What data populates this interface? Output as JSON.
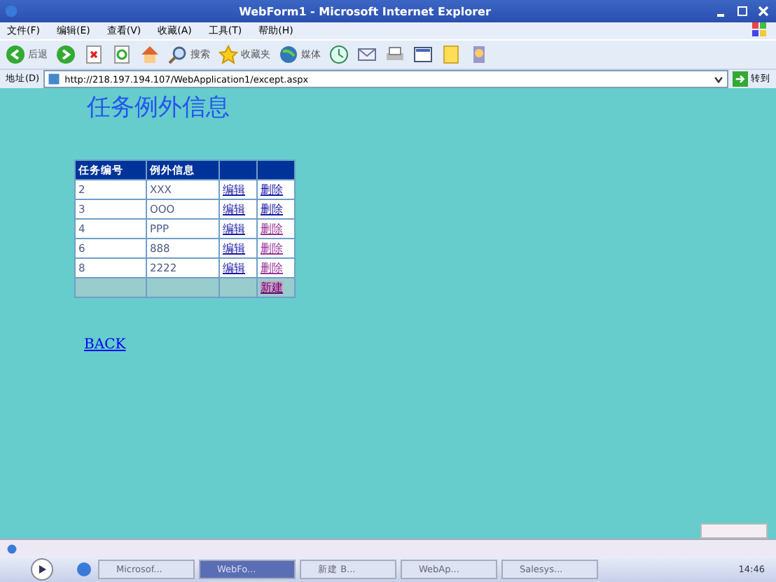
{
  "window": {
    "title": "WebForm1 - Microsoft Internet Explorer"
  },
  "menu": [
    "文件(F)",
    "编辑(E)",
    "查看(V)",
    "收藏(A)",
    "工具(T)",
    "帮助(H)"
  ],
  "toolbar": {
    "back": "后退",
    "search": "搜索",
    "favorites": "收藏夹",
    "media": "媒体"
  },
  "address": {
    "label": "地址(D)",
    "value": "http://218.197.194.107/WebApplication1/except.aspx",
    "go": "转到"
  },
  "page": {
    "heading": "任务例外信息",
    "table": {
      "columns": [
        "任务编号",
        "例外信息"
      ],
      "rows": [
        {
          "id": "2",
          "info": "XXX",
          "edit": "编辑",
          "delete": "删除",
          "visited": false
        },
        {
          "id": "3",
          "info": "OOO",
          "edit": "编辑",
          "delete": "删除",
          "visited": false
        },
        {
          "id": "4",
          "info": "PPP",
          "edit": "编辑",
          "delete": "删除",
          "visited": true
        },
        {
          "id": "6",
          "info": "888",
          "edit": "编辑",
          "delete": "删除",
          "visited": true
        },
        {
          "id": "8",
          "info": "2222",
          "edit": "编辑",
          "delete": "删除",
          "visited": true
        }
      ],
      "new_link": "新建"
    },
    "back_link": "BACK"
  },
  "taskbar": {
    "items": [
      {
        "label": "Microsof...",
        "selected": false
      },
      {
        "label": "WebFo...",
        "selected": true
      },
      {
        "label": "新建 B...",
        "selected": false
      },
      {
        "label": "WebAp...",
        "selected": false
      },
      {
        "label": "Salesys...",
        "selected": false
      }
    ],
    "clock": "14:46"
  }
}
